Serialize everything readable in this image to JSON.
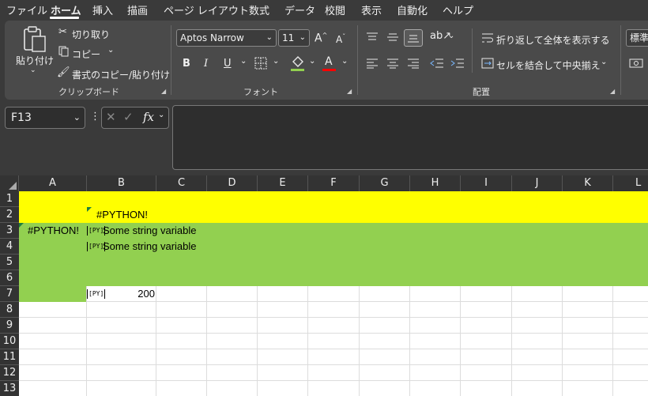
{
  "menu": [
    "ファイル",
    "ホーム",
    "挿入",
    "描画",
    "ページ レイアウト",
    "数式",
    "データ",
    "校閲",
    "表示",
    "自動化",
    "ヘルプ"
  ],
  "ribbon": {
    "clipboard": {
      "paste": "貼り付け",
      "cut": "切り取り",
      "copy": "コピー",
      "format_painter": "書式のコピー/貼り付け",
      "label": "クリップボード"
    },
    "font": {
      "name": "Aptos Narrow",
      "size": "11",
      "bold": "B",
      "italic": "I",
      "underline": "U",
      "font_color": "A",
      "label": "フォント"
    },
    "alignment": {
      "wrap": "折り返して全体を表示する",
      "merge": "セルを結合して中央揃え",
      "label": "配置"
    },
    "number": {
      "format": "標準"
    }
  },
  "formula_bar": {
    "cell_ref": "F13",
    "fx": "fx",
    "content": ""
  },
  "sheet": {
    "columns": [
      "A",
      "B",
      "C",
      "D",
      "E",
      "F",
      "G",
      "H",
      "I",
      "J",
      "K",
      "L"
    ],
    "rows": [
      "1",
      "2",
      "3",
      "4",
      "5",
      "6",
      "7",
      "8",
      "9",
      "10",
      "11",
      "12",
      "13"
    ],
    "cells": {
      "B2": "#PYTHON!",
      "A3": "#PYTHON!",
      "B3": "Some string variable",
      "B4": "Some string variable",
      "B7": "200"
    },
    "py_badge": "[PY]",
    "colors": {
      "yellow": "#ffff00",
      "green": "#92d050"
    }
  }
}
